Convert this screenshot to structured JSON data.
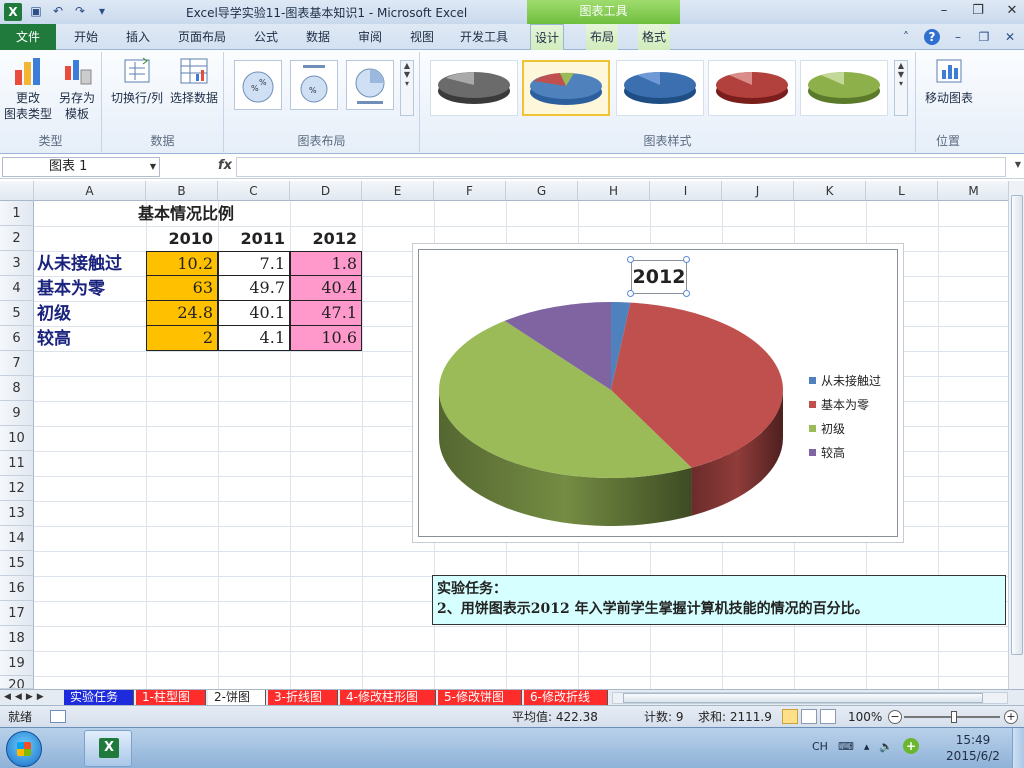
{
  "window": {
    "title": "Excel导学实验11-图表基本知识1  -  Microsoft Excel",
    "context_tab": "图表工具"
  },
  "ribbon_tabs": [
    "开始",
    "插入",
    "页面布局",
    "公式",
    "数据",
    "审阅",
    "视图",
    "开发工具",
    "设计",
    "布局",
    "格式"
  ],
  "file_tab": "文件",
  "ribbon": {
    "change_type": "更改\n图表类型",
    "save_template": "另存为\n模板",
    "switch_row_col": "切换行/列",
    "select_data": "选择数据",
    "move_chart": "移动图表",
    "groups": {
      "type": "类型",
      "data": "数据",
      "layouts": "图表布局",
      "styles": "图表样式",
      "location": "位置"
    }
  },
  "formula_bar": {
    "name_box": "图表 1",
    "fx": "fx",
    "formula": ""
  },
  "columns": [
    "A",
    "B",
    "C",
    "D",
    "E",
    "F",
    "G",
    "H",
    "I",
    "J",
    "K",
    "L",
    "M"
  ],
  "rows": [
    "1",
    "2",
    "3",
    "4",
    "5",
    "6",
    "7",
    "8",
    "9",
    "10",
    "11",
    "12",
    "13",
    "14",
    "15",
    "16",
    "17",
    "18",
    "19",
    "20"
  ],
  "sheet": {
    "title": "基本情况比例",
    "years": [
      "2010",
      "2011",
      "2012"
    ],
    "data_rows": [
      {
        "label": "从未接触过",
        "values": [
          "10.2",
          "7.1",
          "1.8"
        ]
      },
      {
        "label": "基本为零",
        "values": [
          "63",
          "49.7",
          "40.4"
        ]
      },
      {
        "label": "初级",
        "values": [
          "24.8",
          "40.1",
          "47.1"
        ]
      },
      {
        "label": "较高",
        "values": [
          "2",
          "4.1",
          "10.6"
        ]
      }
    ]
  },
  "chart_data": {
    "type": "pie",
    "title": "2012",
    "categories": [
      "从未接触过",
      "基本为零",
      "初级",
      "较高"
    ],
    "values": [
      1.8,
      40.4,
      47.1,
      10.6
    ],
    "colors": [
      "#4f81bd",
      "#c0504d",
      "#9bbb59",
      "#8064a2"
    ],
    "legend": "right",
    "style": "3d"
  },
  "task": {
    "heading": "实验任务：",
    "text": "2、用饼图表示2012 年入学前学生掌握计算机技能的情况的百分比。"
  },
  "sheet_tabs": [
    "实验任务",
    "1-柱型图",
    "2-饼图",
    "3-折线图",
    "4-修改柱形图",
    "5-修改饼图",
    "6-修改折线"
  ],
  "status": {
    "ready": "就绪",
    "average": "平均值: 422.38",
    "count": "计数: 9",
    "sum": "求和: 2111.9",
    "zoom": "100%"
  },
  "taskbar": {
    "lang": "CH",
    "time": "15:49",
    "date": "2015/6/2"
  }
}
